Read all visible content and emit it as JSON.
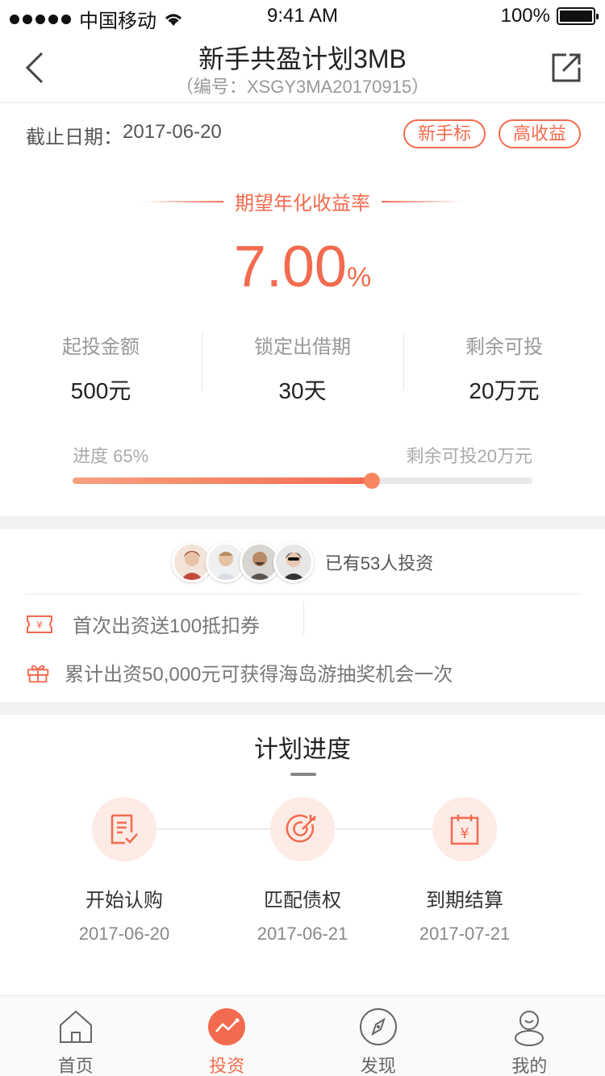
{
  "status_bar": {
    "carrier": "中国移动",
    "time": "9:41 AM",
    "battery": "100%"
  },
  "nav": {
    "title": "新手共盈计划3MB",
    "subtitle": "（编号：XSGY3MA20170915）"
  },
  "info": {
    "deadline_label": "截止日期：",
    "deadline_value": "2017-06-20",
    "tags": [
      "新手标",
      "高收益"
    ]
  },
  "rate": {
    "label": "期望年化收益率",
    "value": "7.00",
    "unit": "%"
  },
  "metrics": [
    {
      "label": "起投金额",
      "value": "500元"
    },
    {
      "label": "锁定出借期",
      "value": "30天"
    },
    {
      "label": "剩余可投",
      "value": "20万元"
    }
  ],
  "progress": {
    "label": "进度 65%",
    "percent": 0.65,
    "remaining": "剩余可投20万元"
  },
  "investors": {
    "text": "已有53人投资",
    "avatars": [
      "avatar-1",
      "avatar-2",
      "avatar-3",
      "avatar-4"
    ]
  },
  "promotions": [
    {
      "icon": "coupon-icon",
      "text": "首次出资送100抵扣券"
    },
    {
      "icon": "gift-icon",
      "text": "累计出资50,000元可获得海岛游抽奖机会一次"
    }
  ],
  "plan": {
    "title": "计划进度",
    "steps": [
      {
        "icon": "document-check-icon",
        "label": "开始认购",
        "date": "2017-06-20"
      },
      {
        "icon": "target-icon",
        "label": "匹配债权",
        "date": "2017-06-21"
      },
      {
        "icon": "calendar-yen-icon",
        "label": "到期结算",
        "date": "2017-07-21"
      }
    ]
  },
  "tabbar": {
    "items": [
      {
        "icon": "home-icon",
        "label": "首页",
        "active": false
      },
      {
        "icon": "invest-icon",
        "label": "投资",
        "active": true
      },
      {
        "icon": "compass-icon",
        "label": "发现",
        "active": false
      },
      {
        "icon": "profile-icon",
        "label": "我的",
        "active": false
      }
    ]
  },
  "colors": {
    "accent": "#f36b4f",
    "accent_light": "#fdebe6",
    "separator": "#f2f2f2"
  }
}
